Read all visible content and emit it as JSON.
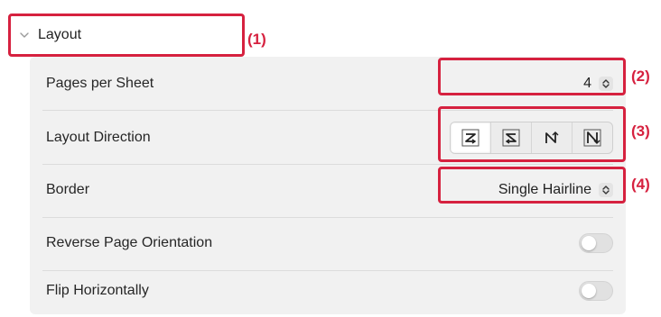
{
  "section": {
    "title": "Layout",
    "expanded": true
  },
  "rows": {
    "pages_per_sheet": {
      "label": "Pages per Sheet",
      "value": "4"
    },
    "layout_direction": {
      "label": "Layout Direction",
      "options": [
        "z-order-icon",
        "reverse-z-order-icon",
        "n-order-icon",
        "reverse-n-order-icon"
      ],
      "selected_index": 0
    },
    "border": {
      "label": "Border",
      "value": "Single Hairline"
    },
    "reverse_orientation": {
      "label": "Reverse Page Orientation",
      "on": false
    },
    "flip_horizontally": {
      "label": "Flip Horizontally",
      "on": false
    }
  },
  "callouts": {
    "c1": "(1)",
    "c2": "(2)",
    "c3": "(3)",
    "c4": "(4)"
  },
  "colors": {
    "highlight": "#d6213f",
    "panel_bg": "#f1f1f1"
  }
}
